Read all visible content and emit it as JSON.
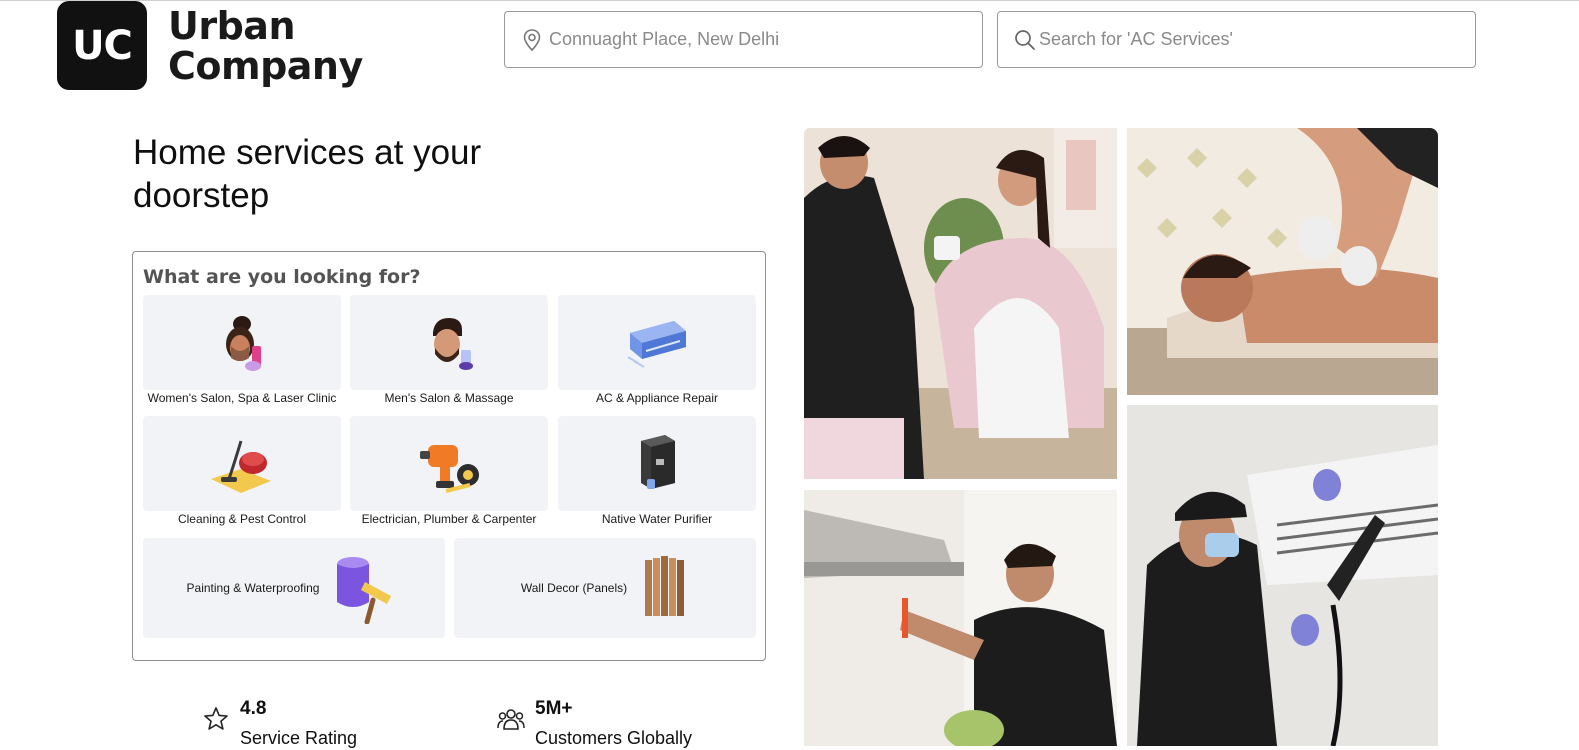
{
  "header": {
    "logo_mark": "UC",
    "logo_line1": "Urban",
    "logo_line2": "Company",
    "location_placeholder": "Connuaght Place, New Delhi",
    "search_placeholder": "Search for 'AC Services'"
  },
  "hero": {
    "title": "Home services at your doorstep",
    "panel_title": "What are you looking for?"
  },
  "services": [
    {
      "label": "Women's Salon, Spa & Laser Clinic",
      "icon": "woman-facial-icon"
    },
    {
      "label": "Men's Salon & Massage",
      "icon": "man-grooming-icon"
    },
    {
      "label": "AC & Appliance Repair",
      "icon": "air-conditioner-icon"
    },
    {
      "label": "Cleaning & Pest Control",
      "icon": "vacuum-cleaner-icon"
    },
    {
      "label": "Electrician, Plumber & Carpenter",
      "icon": "drill-tool-icon"
    },
    {
      "label": "Native Water Purifier",
      "icon": "water-purifier-icon"
    },
    {
      "label": "Painting & Waterproofing",
      "icon": "paint-bucket-roller-icon"
    },
    {
      "label": "Wall Decor (Panels)",
      "icon": "wood-panel-icon"
    }
  ],
  "stats": [
    {
      "value": "4.8",
      "label": "Service Rating",
      "icon": "star-icon"
    },
    {
      "value": "5M+",
      "label": "Customers Globally",
      "icon": "people-icon"
    }
  ],
  "colors": {
    "brand_black": "#111111",
    "tile_bg": "#f1f3f6",
    "border": "#8f8f8f"
  }
}
